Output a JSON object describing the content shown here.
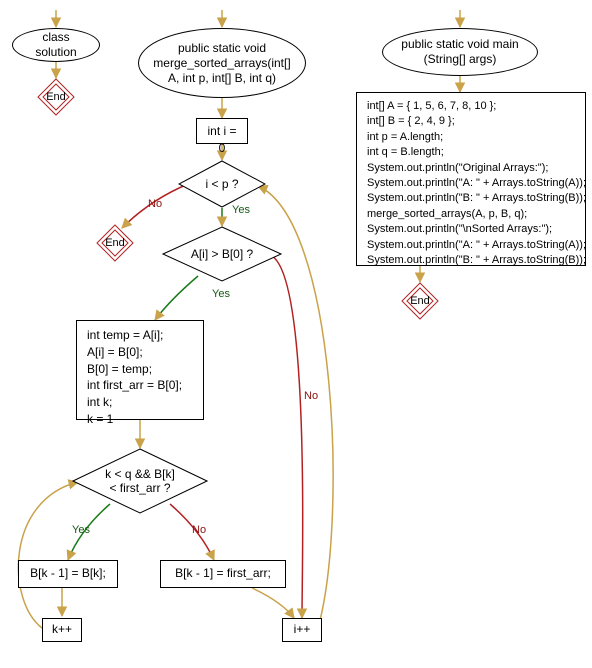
{
  "chart_data": {
    "type": "flowchart",
    "title": "",
    "nodes": [
      {
        "id": "class_solution",
        "shape": "ellipse",
        "text": "class solution"
      },
      {
        "id": "end1",
        "shape": "end",
        "text": "End"
      },
      {
        "id": "merge_sig",
        "shape": "ellipse",
        "text": "public static void\nmerge_sorted_arrays(int[]\nA, int p, int[] B, int q)"
      },
      {
        "id": "init_i",
        "shape": "rect",
        "text": "int i = 0"
      },
      {
        "id": "cond_ip",
        "shape": "diamond",
        "text": "i < p ?"
      },
      {
        "id": "end2",
        "shape": "end",
        "text": "End"
      },
      {
        "id": "cond_ab",
        "shape": "diamond",
        "text": "A[i] > B[0] ?"
      },
      {
        "id": "swap_block",
        "shape": "rect",
        "text": "int temp = A[i];\nA[i] = B[0];\nB[0] = temp;\nint first_arr = B[0];\nint k;\nk = 1"
      },
      {
        "id": "cond_kq",
        "shape": "diamond",
        "text": "k < q && B[k]\n< first_arr ?"
      },
      {
        "id": "assign_bk",
        "shape": "rect",
        "text": "B[k - 1] = B[k];"
      },
      {
        "id": "assign_first",
        "shape": "rect",
        "text": "B[k - 1] = first_arr;"
      },
      {
        "id": "kpp",
        "shape": "rect",
        "text": "k++"
      },
      {
        "id": "ipp",
        "shape": "rect",
        "text": "i++"
      },
      {
        "id": "main_sig",
        "shape": "ellipse",
        "text": "public static void main\n(String[] args)"
      },
      {
        "id": "main_body",
        "shape": "rect",
        "text": "int[] A = { 1, 5, 6, 7, 8, 10 };\nint[] B = { 2, 4, 9 };\nint p = A.length;\nint q = B.length;\nSystem.out.println(\"Original Arrays:\");\nSystem.out.println(\"A: \" + Arrays.toString(A));\nSystem.out.println(\"B: \" + Arrays.toString(B));\nmerge_sorted_arrays(A, p, B, q);\nSystem.out.println(\"\\nSorted Arrays:\");\nSystem.out.println(\"A: \" + Arrays.toString(A));\nSystem.out.println(\"B: \" + Arrays.toString(B));"
      },
      {
        "id": "end3",
        "shape": "end",
        "text": "End"
      }
    ],
    "edges": [
      {
        "from": "__entry1__",
        "to": "class_solution"
      },
      {
        "from": "class_solution",
        "to": "end1"
      },
      {
        "from": "__entry2__",
        "to": "merge_sig"
      },
      {
        "from": "merge_sig",
        "to": "init_i"
      },
      {
        "from": "init_i",
        "to": "cond_ip"
      },
      {
        "from": "cond_ip",
        "to": "end2",
        "label": "No"
      },
      {
        "from": "cond_ip",
        "to": "cond_ab",
        "label": "Yes"
      },
      {
        "from": "cond_ab",
        "to": "swap_block",
        "label": "Yes"
      },
      {
        "from": "cond_ab",
        "to": "ipp",
        "label": "No"
      },
      {
        "from": "swap_block",
        "to": "cond_kq"
      },
      {
        "from": "cond_kq",
        "to": "assign_bk",
        "label": "Yes"
      },
      {
        "from": "cond_kq",
        "to": "assign_first",
        "label": "No"
      },
      {
        "from": "assign_bk",
        "to": "kpp"
      },
      {
        "from": "assign_first",
        "to": "ipp"
      },
      {
        "from": "kpp",
        "to": "cond_kq"
      },
      {
        "from": "ipp",
        "to": "cond_ip"
      },
      {
        "from": "__entry3__",
        "to": "main_sig"
      },
      {
        "from": "main_sig",
        "to": "main_body"
      },
      {
        "from": "main_body",
        "to": "end3"
      }
    ]
  },
  "labels": {
    "yes": "Yes",
    "no": "No",
    "end": "End"
  },
  "nodeText": {
    "class_solution": "class solution",
    "merge_sig": "public static void merge_sorted_arrays(int[] A, int p, int[] B, int q)",
    "init_i": "int i = 0",
    "cond_ip": "i < p ?",
    "cond_ab": "A[i] > B[0] ?",
    "swap_block": "int temp = A[i];\nA[i] = B[0];\nB[0] = temp;\nint first_arr = B[0];\nint k;\nk = 1",
    "cond_kq": "k < q && B[k]\n< first_arr ?",
    "assign_bk": "B[k - 1] = B[k];",
    "assign_first": "B[k - 1] = first_arr;",
    "kpp": "k++",
    "ipp": "i++",
    "main_sig": "public static void main (String[] args)",
    "main_body": "int[] A = { 1, 5, 6, 7, 8, 10 };\nint[] B = { 2, 4, 9 };\nint p = A.length;\nint q = B.length;\nSystem.out.println(\"Original Arrays:\");\nSystem.out.println(\"A: \" + Arrays.toString(A));\nSystem.out.println(\"B: \" + Arrays.toString(B));\nmerge_sorted_arrays(A, p, B, q);\nSystem.out.println(\"\\nSorted Arrays:\");\nSystem.out.println(\"A: \" + Arrays.toString(A));\nSystem.out.println(\"B: \" + Arrays.toString(B));"
  }
}
